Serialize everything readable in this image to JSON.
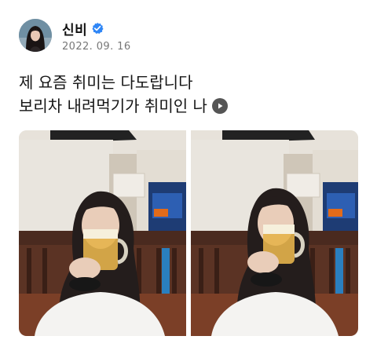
{
  "post": {
    "author_name": "신비",
    "date": "2022. 09. 16",
    "text_line1": "제 요즘 취미는 다도랍니다",
    "text_line2": "보리차 내려먹기가 취미인 나"
  },
  "icons": {
    "verified": "verified-badge-icon",
    "play": "play-icon"
  },
  "colors": {
    "verified_blue": "#2f86f6",
    "date_gray": "#777777",
    "play_gray": "#555555"
  },
  "photos": [
    {
      "name": "photo-left",
      "scene": "woman drinking beer from mug"
    },
    {
      "name": "photo-right",
      "scene": "woman drinking beer from mug, eyes closed"
    }
  ]
}
